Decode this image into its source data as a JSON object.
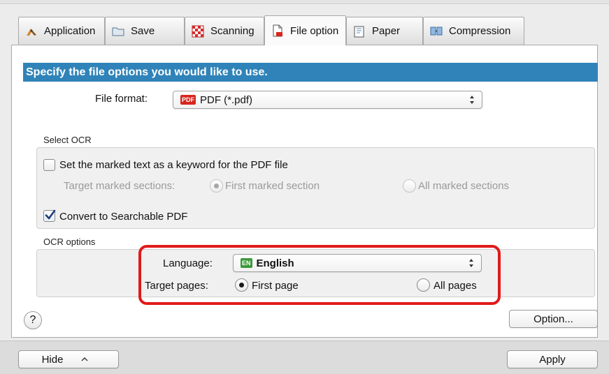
{
  "tabs": [
    {
      "label": "Application",
      "icon": "application-icon"
    },
    {
      "label": "Save",
      "icon": "folder-icon"
    },
    {
      "label": "Scanning",
      "icon": "scanning-icon"
    },
    {
      "label": "File option",
      "icon": "file-option-icon",
      "active": true
    },
    {
      "label": "Paper",
      "icon": "paper-icon"
    },
    {
      "label": "Compression",
      "icon": "compression-icon"
    }
  ],
  "banner": "Specify the file options you would like to use.",
  "file_format": {
    "label": "File format:",
    "value": "PDF (*.pdf)",
    "badge": "PDF"
  },
  "select_ocr": {
    "title": "Select OCR",
    "keyword_checkbox": {
      "label": "Set the marked text as a keyword for the PDF file",
      "checked": false
    },
    "target_marked_sections": {
      "label": "Target marked sections:",
      "options": [
        "First marked section",
        "All marked sections"
      ],
      "selected": "First marked section",
      "enabled": false
    },
    "searchable_checkbox": {
      "label": "Convert to Searchable PDF",
      "checked": true
    }
  },
  "ocr_options": {
    "title": "OCR options",
    "language": {
      "label": "Language:",
      "value": "English",
      "badge": "EN"
    },
    "target_pages": {
      "label": "Target pages:",
      "options": [
        "First page",
        "All pages"
      ],
      "selected": "First page"
    }
  },
  "buttons": {
    "help": "?",
    "option": "Option...",
    "hide": "Hide",
    "apply": "Apply"
  },
  "colors": {
    "banner": "#2f83b8",
    "highlight": "#e11a1a",
    "pdf_badge": "#d8261c",
    "en_badge": "#3c9a3a",
    "checkbox_check": "#1c3f7a"
  }
}
